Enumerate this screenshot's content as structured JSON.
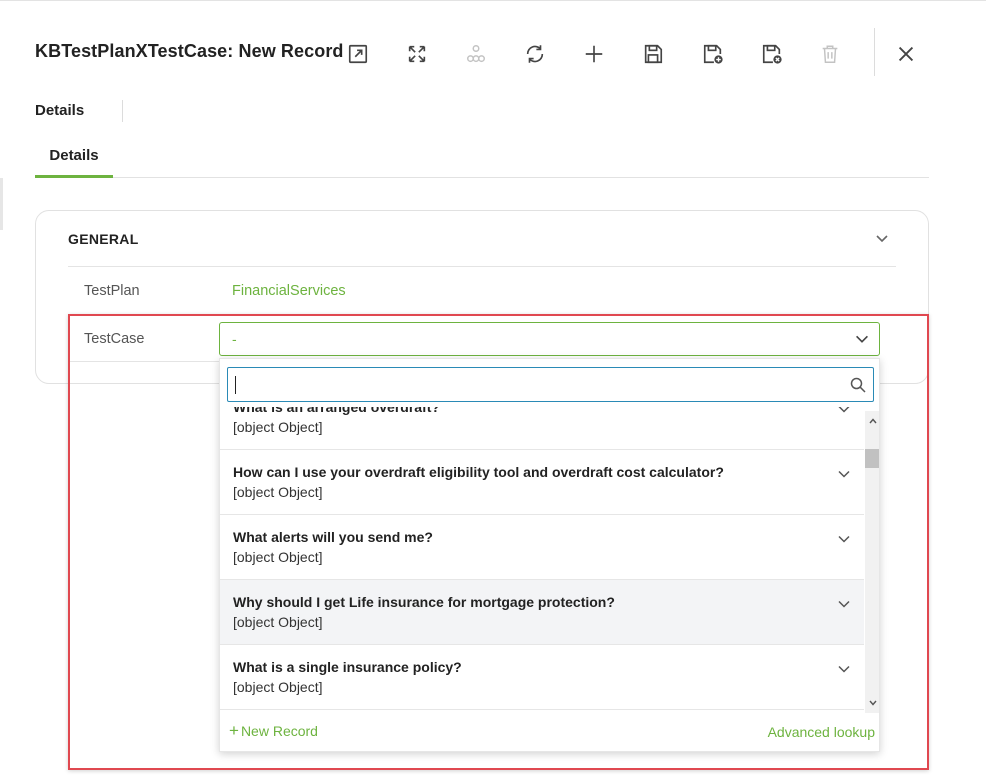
{
  "record": {
    "title": "KBTestPlanXTestCase: New Record",
    "header_tab": "Details"
  },
  "toolbar": {
    "buttons": [
      {
        "name": "open-in-new-window-button",
        "icon": "external-link-icon"
      },
      {
        "name": "maximize-button",
        "icon": "expand-icon"
      },
      {
        "name": "hierarchy-button",
        "icon": "hierarchy-icon",
        "disabled": true
      },
      {
        "name": "refresh-button",
        "icon": "refresh-icon"
      },
      {
        "name": "new-button",
        "icon": "plus-icon"
      },
      {
        "name": "save-button",
        "icon": "save-icon"
      },
      {
        "name": "save-and-new-button",
        "icon": "save-new-icon"
      },
      {
        "name": "save-and-close-button",
        "icon": "save-close-icon"
      },
      {
        "name": "delete-button",
        "icon": "trash-icon",
        "disabled": true
      },
      {
        "name": "close-button",
        "icon": "close-icon"
      }
    ]
  },
  "tabs": [
    {
      "label": "Details",
      "active": true
    }
  ],
  "section": {
    "title": "GENERAL",
    "fields": {
      "testplan_label": "TestPlan",
      "testplan_value": "FinancialServices",
      "testcase_label": "TestCase",
      "testcase_value": "-"
    }
  },
  "dropdown": {
    "search_value": "",
    "items": [
      {
        "title": "What is an arranged overdraft?",
        "subtitle": "[object Object]"
      },
      {
        "title": "How can I use your overdraft eligibility tool and overdraft cost calculator?",
        "subtitle": "[object Object]"
      },
      {
        "title": "What alerts will you send me?",
        "subtitle": "[object Object]"
      },
      {
        "title": "Why should I get Life insurance for mortgage protection?",
        "subtitle": "[object Object]",
        "hover": true
      },
      {
        "title": "What is a single insurance policy?",
        "subtitle": "[object Object]"
      }
    ],
    "new_record_label": "New Record",
    "advanced_lookup_label": "Advanced lookup"
  },
  "colors": {
    "accent": "#6db33f",
    "focus": "#2a8ab6",
    "highlight": "#e04850"
  }
}
